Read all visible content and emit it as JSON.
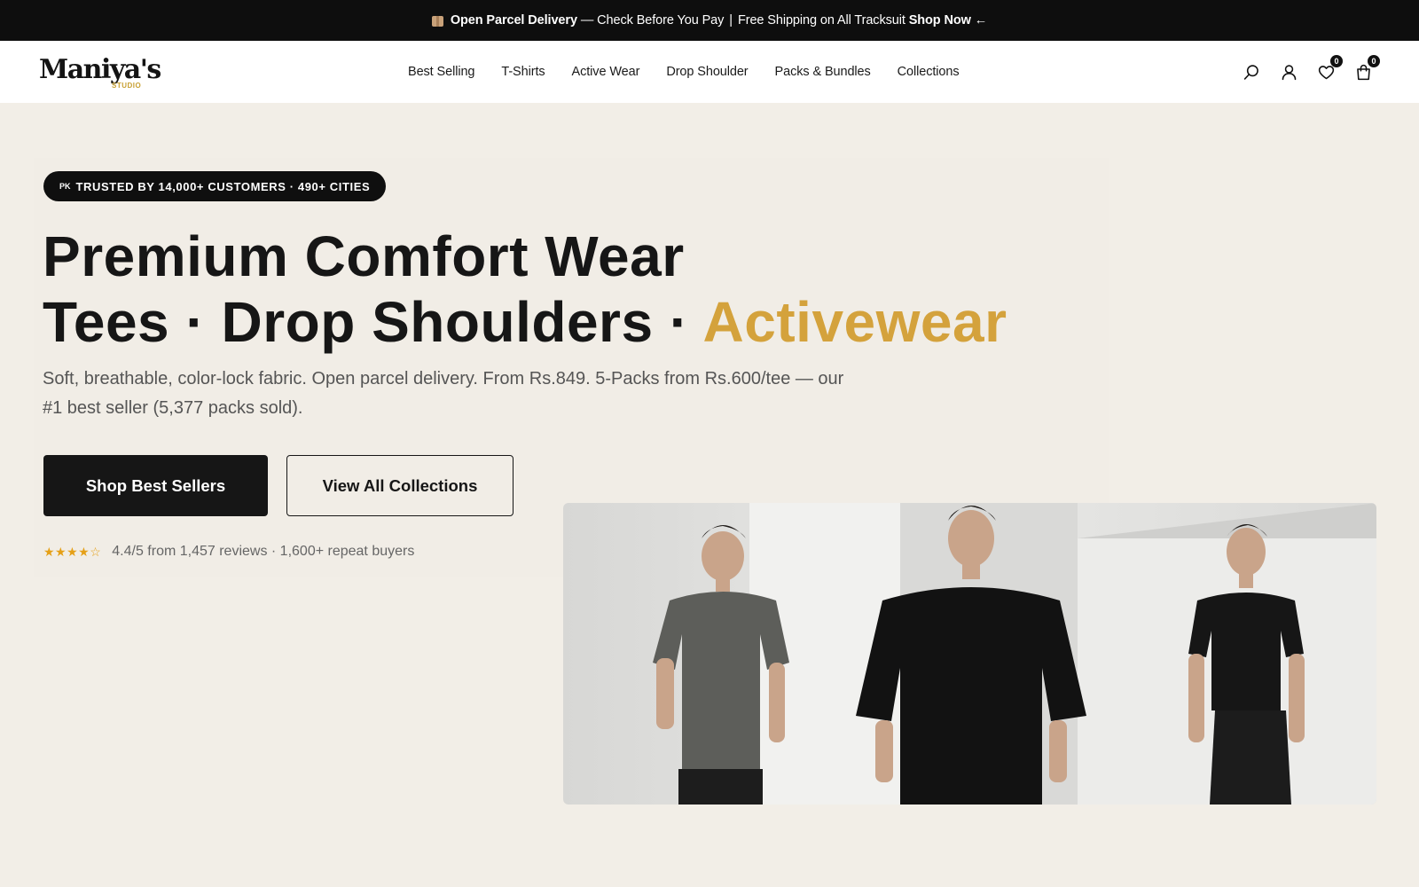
{
  "announcement": {
    "bold_lead": "Open Parcel Delivery",
    "text": "— Check Before You Pay",
    "divider": "|",
    "text2": "Free Shipping on All Tracksuit",
    "cta": "Shop Now",
    "cta_arrow": "←"
  },
  "brand": {
    "logo_text": "Maniya's",
    "logo_sub": "STUDIO"
  },
  "nav": {
    "items": [
      "Best Selling",
      "T-Shirts",
      "Active Wear",
      "Drop Shoulder",
      "Packs & Bundles",
      "Collections"
    ]
  },
  "header_icons": {
    "search": "search-icon",
    "account": "user-icon",
    "wishlist": "heart-icon",
    "wishlist_count": "0",
    "cart": "bag-icon",
    "cart_count": "0"
  },
  "hero": {
    "badge_flag": "PK",
    "badge": "TRUSTED BY 14,000+ CUSTOMERS · 490+ CITIES",
    "title_line1": "Premium Comfort Wear",
    "title_line2_prefix": "Tees · Drop Shoulders · ",
    "title_line2_accent": "Activewear",
    "subtitle": "Soft, breathable, color-lock fabric. Open parcel delivery. From Rs.849. 5-Packs from Rs.600/tee — our #1 best seller (5,377 packs sold).",
    "primary_cta": "Shop Best Sellers",
    "secondary_cta": "View All Collections",
    "stars": "★★★★☆",
    "rating_text": "4.4/5 from 1,457 reviews · 1,600+ repeat buyers"
  },
  "colors": {
    "accent": "#d4a23c",
    "dark": "#161616",
    "background": "#f2eee7"
  }
}
